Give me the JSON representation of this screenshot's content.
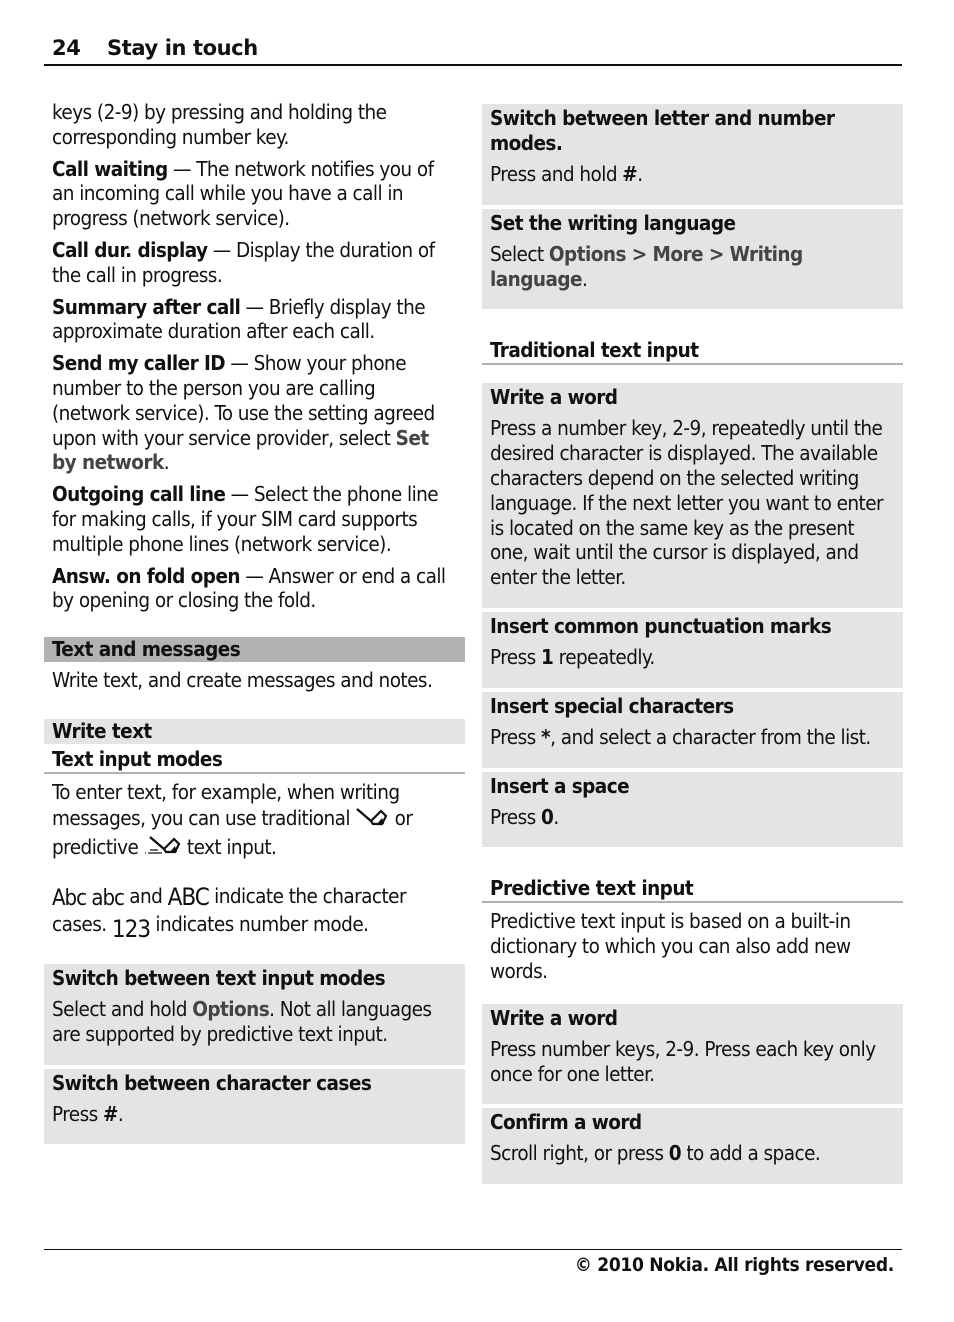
{
  "header": {
    "page_number": "24",
    "chapter_title": "Stay in touch"
  },
  "left_column": {
    "intro_continuation": "keys (2-9) by pressing and holding the corresponding number key.",
    "settings": [
      {
        "term": "Call waiting",
        "separator": " — ",
        "desc": "The network notifies you of an incoming call while you have a call in progress (network service)."
      },
      {
        "term": "Call dur. display",
        "separator": " — ",
        "desc": "Display the duration of the call in progress."
      },
      {
        "term": "Summary after call",
        "separator": " — ",
        "desc": "Briefly display the approximate duration after each call."
      },
      {
        "term": "Send my caller ID",
        "separator": " — ",
        "desc": "Show your phone number to the person you are calling (network service). To use the setting agreed upon with your service provider, select ",
        "ui_option": "Set by network",
        "desc_end": "."
      },
      {
        "term": "Outgoing call line",
        "separator": " — ",
        "desc": "Select the phone line for making calls, if your SIM card supports multiple phone lines (network service)."
      },
      {
        "term": "Answ. on fold open",
        "separator": " — ",
        "desc": "Answer or end a call by opening or closing the fold."
      }
    ],
    "text_and_messages": {
      "heading": "Text and messages",
      "body": "Write text, and create messages and notes."
    },
    "write_text": {
      "heading": "Write text",
      "subheading": "Text input modes",
      "modes_p1": "To enter text, for example, when writing messages, you can use traditional ",
      "modes_p1_or": " or predictive ",
      "modes_p1_end": " text input.",
      "traditional_icon": "traditional-input-icon",
      "predictive_icon": "predictive-input-icon",
      "case_icons": [
        "Abc",
        "abc",
        "ABC"
      ],
      "case_and": " and ",
      "case_text": " indicate the character cases. ",
      "number_icon": "123",
      "number_text": " indicates number mode."
    },
    "tasks": [
      {
        "title": "Switch between text input modes",
        "body_pre": "Select and hold ",
        "ui": "Options",
        "body_post": ". Not all languages are supported by predictive text input."
      },
      {
        "title": "Switch between character cases",
        "body_pre": "Press ",
        "key": "#",
        "body_post": "."
      }
    ]
  },
  "right_column": {
    "tasks_top": [
      {
        "title": "Switch between letter and number modes.",
        "body_pre": "Press and hold ",
        "key": "#",
        "body_post": "."
      },
      {
        "title": "Set the writing language",
        "body_pre": "Select ",
        "path": [
          "Options",
          "More",
          "Writing language"
        ],
        "path_sep": " > ",
        "body_post": "."
      }
    ],
    "traditional": {
      "heading": "Traditional text input",
      "tasks": [
        {
          "title": "Write a word",
          "body": "Press a number key, 2-9, repeatedly until the desired character is displayed. The available characters depend on the selected writing language. If the next letter you want to enter is located on the same key as the present one, wait until the cursor is displayed, and enter the letter."
        },
        {
          "title": "Insert common punctuation marks",
          "body_pre": "Press ",
          "key": "1",
          "body_post": " repeatedly."
        },
        {
          "title": "Insert special characters",
          "body_pre": "Press ",
          "key": "*",
          "body_post": ", and select a character from the list."
        },
        {
          "title": "Insert a space",
          "body_pre": "Press ",
          "key": "0",
          "body_post": "."
        }
      ]
    },
    "predictive": {
      "heading": "Predictive text input",
      "intro": "Predictive text input is based on a built-in dictionary to which you can also add new words.",
      "tasks": [
        {
          "title": "Write a word",
          "body": "Press number keys, 2-9. Press each key only once for one letter."
        },
        {
          "title": "Confirm a word",
          "body_pre": "Scroll right, or press ",
          "key": "0",
          "body_post": " to add a space."
        }
      ]
    }
  },
  "footer": {
    "copyright": "© 2010 Nokia. All rights reserved."
  },
  "colors": {
    "section_dark": "#b2b2b2",
    "section_light": "#e4e4e4",
    "ui_text": "#444444",
    "text": "#111111"
  }
}
